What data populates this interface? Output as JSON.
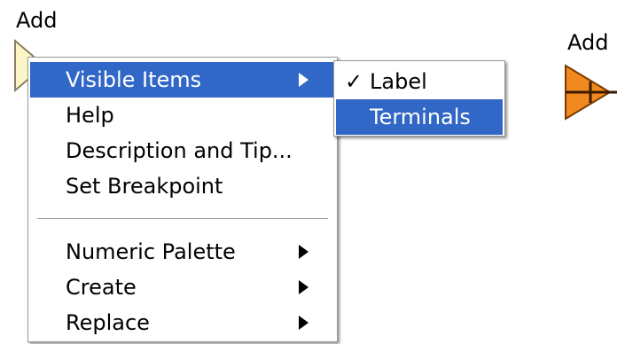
{
  "diagram": {
    "left_node_label": "Add",
    "right_node_label": "Add",
    "left_node_icon": "add-terminal-icon",
    "right_node_icon": "add-function-icon",
    "left_node_color": "#fbf5c8",
    "right_node_color": "#f08a1e"
  },
  "context_menu": {
    "items": [
      {
        "label": "Visible Items",
        "has_submenu": true,
        "highlighted": true
      },
      {
        "label": "Help"
      },
      {
        "label": "Description and Tip..."
      },
      {
        "label": "Set Breakpoint"
      },
      {
        "label": "Numeric Palette",
        "has_submenu": true
      },
      {
        "label": "Create",
        "has_submenu": true
      },
      {
        "label": "Replace",
        "has_submenu": true
      }
    ],
    "highlight_color": "#3167c6"
  },
  "submenu": {
    "items": [
      {
        "label": "Label",
        "checked": true,
        "check_glyph": "✓"
      },
      {
        "label": "Terminals",
        "highlighted": true
      }
    ]
  }
}
